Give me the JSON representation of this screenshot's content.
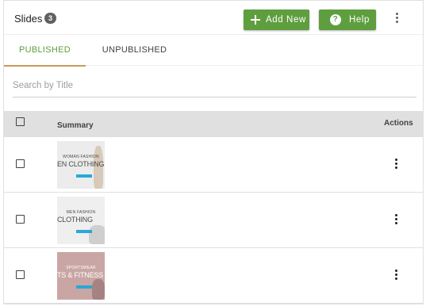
{
  "header": {
    "title": "Slides",
    "count": "3",
    "add_new_label": "Add New",
    "help_label": "Help",
    "help_icon_glyph": "?"
  },
  "tabs": [
    {
      "label": "PUBLISHED",
      "active": true
    },
    {
      "label": "UNPUBLISHED",
      "active": false
    }
  ],
  "search": {
    "placeholder": "Search by Title",
    "value": ""
  },
  "table": {
    "columns": {
      "summary": "Summary",
      "actions": "Actions"
    },
    "rows": [
      {
        "thumb_subtitle": "WOMAN FASHION",
        "thumb_title": "EN CLOTHING",
        "thumb_bg": "#ececec",
        "thumb_text": "#4a4a4a",
        "figure": "#d8c9b8"
      },
      {
        "thumb_subtitle": "MEN FASHION",
        "thumb_title": "CLOTHING",
        "thumb_bg": "#efefef",
        "thumb_text": "#4a4a4a",
        "figure": "#cfcfcf"
      },
      {
        "thumb_subtitle": "SPORTSWEAR",
        "thumb_title": "TS & FITNESS",
        "thumb_bg": "#c9a6a4",
        "thumb_text": "#ffffff",
        "figure": "#a58382"
      }
    ]
  },
  "colors": {
    "accent_green": "#5e9e3e",
    "tab_indicator": "#c99a5b",
    "header_row_bg": "#e0e0e0",
    "thumb_cta": "#29a8d8"
  },
  "icons": {
    "add": "plus-icon",
    "help": "help-circle-icon",
    "more": "more-vertical-icon"
  }
}
